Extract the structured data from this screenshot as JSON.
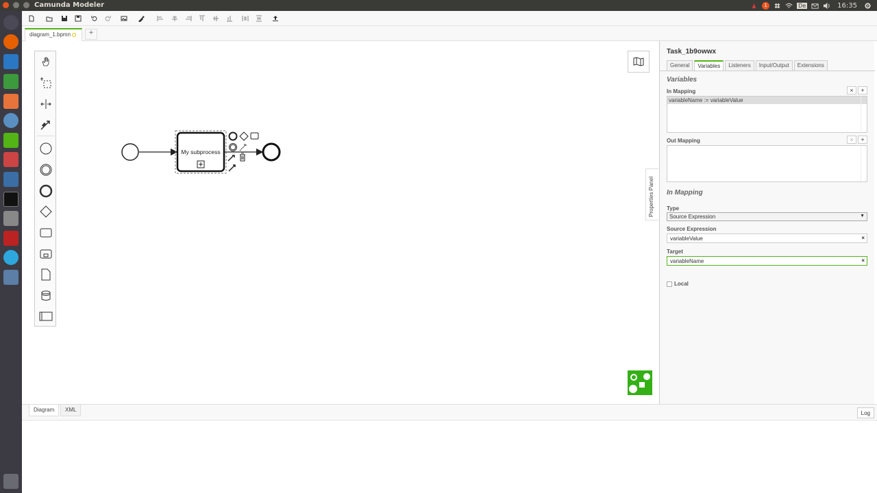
{
  "system": {
    "window_title": "Camunda Modeler",
    "clock": "16:35",
    "keyboard_layout": "De",
    "notification_count": "1"
  },
  "tabs": {
    "file_tab": "diagram_1.bpmn",
    "add_tab": "+"
  },
  "diagram": {
    "subprocess_label": "My subprocess"
  },
  "bottom": {
    "diagram_tab": "Diagram",
    "xml_tab": "XML",
    "log_button": "Log"
  },
  "properties": {
    "toggle_label": "Properties Panel",
    "element_id": "Task_1b9owwx",
    "tabs": [
      "General",
      "Variables",
      "Listeners",
      "Input/Output",
      "Extensions"
    ],
    "active_tab": "Variables",
    "section_variables": "Variables",
    "in_mapping_label": "In Mapping",
    "in_mapping_items": [
      "variableName := variableValue"
    ],
    "out_mapping_label": "Out Mapping",
    "detail_title": "In Mapping",
    "type_label": "Type",
    "type_value": "Source Expression",
    "source_expression_label": "Source Expression",
    "source_expression_value": "variableValue",
    "target_label": "Target",
    "target_value": "variableName",
    "local_label": "Local",
    "remove_symbol": "×",
    "add_symbol": "+"
  },
  "colors": {
    "accent": "#52b415",
    "camunda_logo": "#34b016",
    "topbar": "#3a3a37",
    "launcher": "#3c3b44"
  }
}
